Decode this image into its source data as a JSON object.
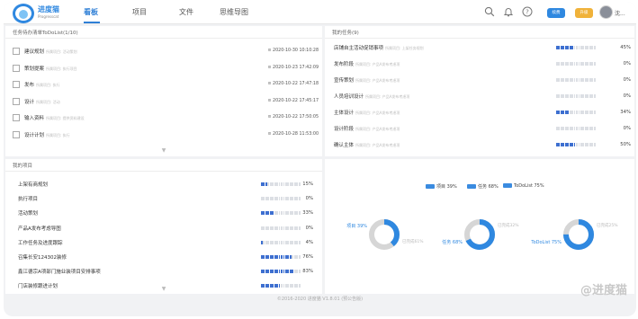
{
  "brand": {
    "name": "进度猫",
    "sub": "Progresscat"
  },
  "nav": [
    {
      "label": "看板",
      "active": true
    },
    {
      "label": "项目",
      "active": false
    },
    {
      "label": "文件",
      "active": false
    },
    {
      "label": "思维导图",
      "active": false
    }
  ],
  "header": {
    "pill1": "续费",
    "pill2": "升级",
    "user": "沈..."
  },
  "tasks_panel": {
    "title": "任务待办清单ToDoList(1/10)",
    "items": [
      {
        "name": "建议规划",
        "sub": "所属项目: 活动策划",
        "time": "2020-10-30 10:10:28"
      },
      {
        "name": "策划提案",
        "sub": "所属项目: 执行项目",
        "time": "2020-10-23 17:42:09"
      },
      {
        "name": "发布",
        "sub": "所属项目: 执行",
        "time": "2020-10-22 17:47:18"
      },
      {
        "name": "设计",
        "sub": "所属项目: 活动",
        "time": "2020-10-22 17:45:17"
      },
      {
        "name": "输入资料",
        "sub": "所属项目: 提供资料建设",
        "time": "2020-10-22 17:50:05"
      },
      {
        "name": "设计计划",
        "sub": "所属项目: 执行",
        "time": "2020-10-28 11:53:00"
      }
    ]
  },
  "mytasks_panel": {
    "title": "我的任务(9)",
    "items": [
      {
        "name": "店铺自主活动促销事项",
        "sub": "所属项目: 上架任务规划",
        "percent": "45%",
        "fill": 0.45
      },
      {
        "name": "发布阶段",
        "sub": "所属项目: 产品A发布考虑项",
        "percent": "0%",
        "fill": 0
      },
      {
        "name": "宣传策划",
        "sub": "所属项目: 产品A发布考虑项",
        "percent": "0%",
        "fill": 0
      },
      {
        "name": "人员培训设计",
        "sub": "所属项目: 产品A发布考虑项",
        "percent": "0%",
        "fill": 0
      },
      {
        "name": "主体设计",
        "sub": "所属项目: 产品A发布考虑项",
        "percent": "34%",
        "fill": 0.34
      },
      {
        "name": "设计阶段",
        "sub": "所属项目: 产品A发布考虑项",
        "percent": "0%",
        "fill": 0
      },
      {
        "name": "确认主体",
        "sub": "所属项目: 产品A发布考虑项",
        "percent": "50%",
        "fill": 0.5
      }
    ]
  },
  "projects_panel": {
    "title": "我的项目",
    "items": [
      {
        "name": "上架有商规划",
        "percent": "15%",
        "fill": 0.15
      },
      {
        "name": "执行项目",
        "percent": "0%",
        "fill": 0
      },
      {
        "name": "活动策划",
        "percent": "33%",
        "fill": 0.33
      },
      {
        "name": "产品A发布考虑导图",
        "percent": "0%",
        "fill": 0
      },
      {
        "name": "工作任务及进度跟踪",
        "percent": "4%",
        "fill": 0.04
      },
      {
        "name": "召集长安124302装修",
        "percent": "76%",
        "fill": 0.76
      },
      {
        "name": "鑫江德宗A项部门施业装项目安排事项",
        "percent": "83%",
        "fill": 0.83
      },
      {
        "name": "门店装修跟进计划",
        "percent": "",
        "fill": 0.5
      }
    ]
  },
  "stats_panel": {
    "legend": [
      "项目 39%",
      "任务 68%",
      "ToDoList 75%"
    ],
    "donuts": [
      {
        "label": "项目 39%",
        "rest": "已完成61%",
        "value": 0.39
      },
      {
        "label": "任务 68%",
        "rest": "已完成32%",
        "value": 0.68
      },
      {
        "label": "ToDoList 75%",
        "rest": "已完成25%",
        "value": 0.75
      }
    ]
  },
  "colors": {
    "accent": "#2f88e0",
    "bar_on": "#3d6fd0",
    "donut_rest": "#d6d6d6"
  },
  "footer": "©2016-2020 进度猫 V1.8.01 (预公告版)",
  "watermark": "@进度猫"
}
